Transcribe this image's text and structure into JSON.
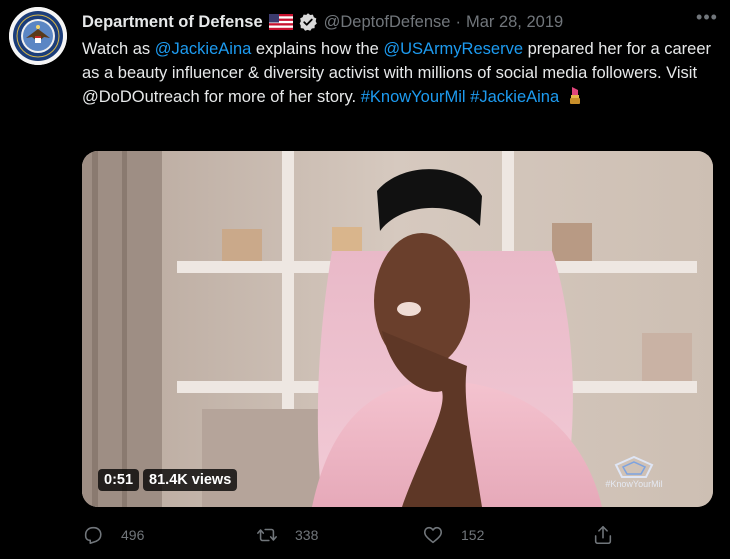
{
  "tweet": {
    "author_name": "Department of Defense",
    "handle": "@DeptofDefense",
    "separator": "·",
    "date": "Mar 28, 2019",
    "more_icon": "more-horizontal-icon",
    "text": {
      "t1": "Watch as ",
      "mention1": "@JackieAina",
      "t2": " explains how the ",
      "mention2": "@USArmyReserve",
      "t3": " prepared her for a career as a beauty influencer & diversity activist with millions of social media followers. Visit @DoDOutreach for more of her story. ",
      "hashtag1": "#KnowYourMil",
      "hashtag2": "#JackieAina"
    },
    "link_color": "#1d9bf0"
  },
  "media": {
    "duration": "0:51",
    "views": "81.4K views",
    "watermark_text": "#KnowYourMil"
  },
  "actions": {
    "replies": "496",
    "retweets": "338",
    "likes": "152"
  }
}
